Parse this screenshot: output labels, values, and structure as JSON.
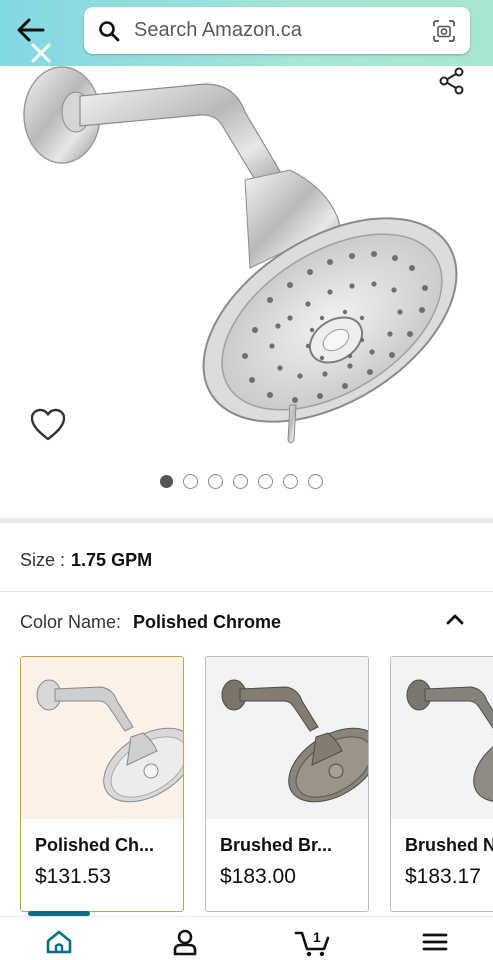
{
  "header": {
    "search_placeholder": "Search Amazon.ca",
    "back_icon": "back-arrow-icon",
    "close_icon": "close-icon",
    "search_icon": "search-icon",
    "lens_icon": "camera-lens-icon"
  },
  "product": {
    "image_count": 7,
    "active_image_index": 0,
    "share_icon": "share-icon",
    "wishlist_icon": "heart-icon"
  },
  "size": {
    "label": "Size :",
    "value": "1.75 GPM"
  },
  "color": {
    "label": "Color Name:",
    "value": "Polished Chrome"
  },
  "swatches": [
    {
      "name": "Polished Ch...",
      "price": "$131.53",
      "selected": true
    },
    {
      "name": "Brushed Br...",
      "price": "$183.00",
      "selected": false
    },
    {
      "name": "Brushed N",
      "price": "$183.17",
      "selected": false
    }
  ],
  "nav": {
    "items": [
      "home-icon",
      "account-icon",
      "cart-icon",
      "menu-icon"
    ],
    "cart_count": "1"
  },
  "colors": {
    "header_start": "#82d8e3",
    "header_end": "#a9e6cf",
    "selected_border": "#c9a14a",
    "active_tab": "#007185"
  }
}
